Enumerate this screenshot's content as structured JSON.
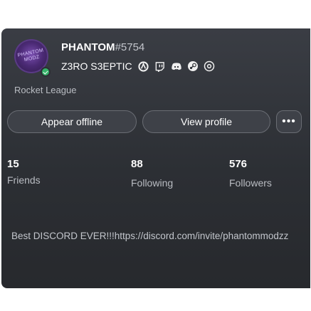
{
  "profile": {
    "username": "PHANTOM",
    "discriminator": "#5754",
    "avatar_text": "PHANTOM MODZ",
    "status": "online",
    "title": "Z3RO S3EPTIC",
    "title_icons": [
      "overwatch-icon",
      "twitch-icon",
      "discord-icon",
      "steam-icon",
      "settings-icon"
    ],
    "game": "Rocket League"
  },
  "actions": {
    "appear_offline": "Appear offline",
    "view_profile": "View profile",
    "more": "•••"
  },
  "stats": {
    "friends_count": "15",
    "friends_label": "Friends",
    "following_count": "88",
    "following_label": "Following",
    "followers_count": "576",
    "followers_label": "Followers"
  },
  "bio": "Best DISCORD EVER!!!https://discord.com/invite/phantommodzz",
  "colors": {
    "panel": "#2c2f34",
    "online": "#35b36a",
    "button": "#3e4148"
  }
}
